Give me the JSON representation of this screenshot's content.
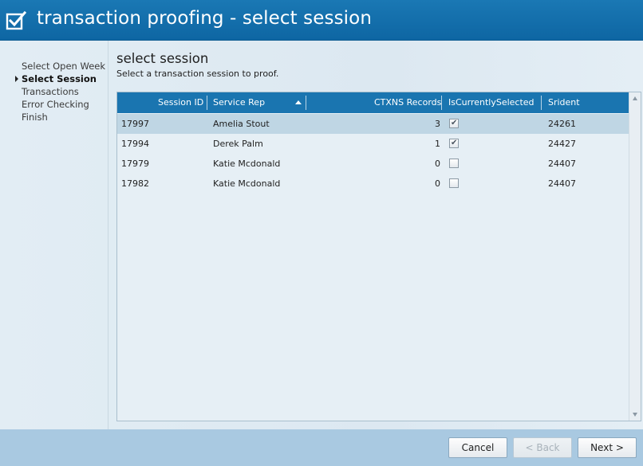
{
  "window": {
    "title": "transaction proofing - select session",
    "title_icon": "checkbox-checked-icon"
  },
  "sidebar": {
    "items": [
      {
        "label": "Select Open Week",
        "active": false
      },
      {
        "label": "Select Session",
        "active": true
      },
      {
        "label": "Transactions",
        "active": false
      },
      {
        "label": "Error Checking",
        "active": false
      },
      {
        "label": "Finish",
        "active": false
      }
    ]
  },
  "page": {
    "heading": "select session",
    "subtitle": "Select a transaction session to proof."
  },
  "grid": {
    "columns": [
      {
        "key": "session_id",
        "label": "Session ID"
      },
      {
        "key": "service_rep",
        "label": "Service Rep",
        "sorted": "ascending"
      },
      {
        "key": "ctxns_records",
        "label": "CTXNS Records"
      },
      {
        "key": "is_currently_selected",
        "label": "IsCurrentlySelected"
      },
      {
        "key": "srident",
        "label": "Srident"
      }
    ],
    "rows": [
      {
        "session_id": "17997",
        "service_rep": "Amelia Stout",
        "ctxns_records": "3",
        "is_currently_selected": true,
        "srident": "24261",
        "selected": true
      },
      {
        "session_id": "17994",
        "service_rep": "Derek Palm",
        "ctxns_records": "1",
        "is_currently_selected": true,
        "srident": "24427",
        "selected": false
      },
      {
        "session_id": "17979",
        "service_rep": "Katie Mcdonald",
        "ctxns_records": "0",
        "is_currently_selected": false,
        "srident": "24407",
        "selected": false
      },
      {
        "session_id": "17982",
        "service_rep": "Katie Mcdonald",
        "ctxns_records": "0",
        "is_currently_selected": false,
        "srident": "24407",
        "selected": false
      }
    ]
  },
  "footer": {
    "cancel_label": "Cancel",
    "back_label": "< Back",
    "next_label": "Next >",
    "back_enabled": false
  },
  "colors": {
    "title_bar": "#1a78b4",
    "grid_header": "#1a75b0",
    "selected_row": "#bfd6e4",
    "footer_bar": "#a9c9e1"
  }
}
